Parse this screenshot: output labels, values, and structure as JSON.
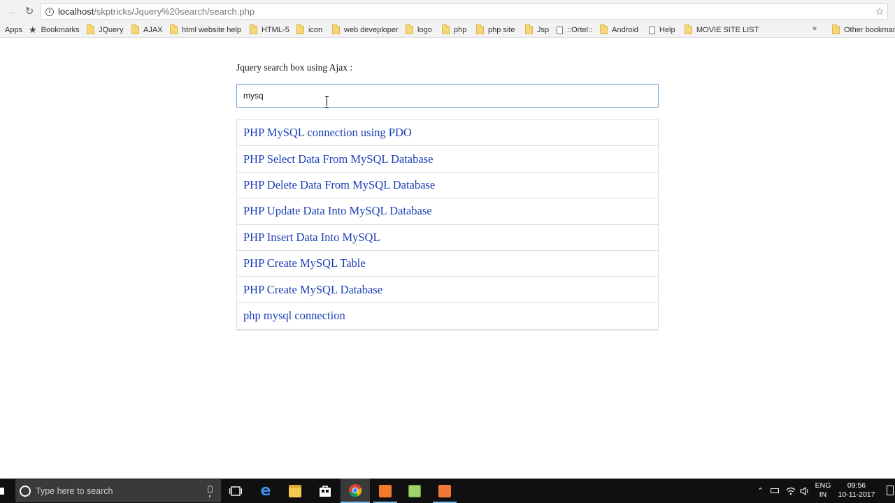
{
  "browser": {
    "url_host": "localhost",
    "url_path": "/skptricks/Jquery%20search/search.php"
  },
  "bookmarks": {
    "apps": "Apps",
    "items": [
      {
        "label": "Bookmarks",
        "icon": "star-icon"
      },
      {
        "label": "JQuery",
        "icon": "folder-icon"
      },
      {
        "label": "AJAX",
        "icon": "folder-icon"
      },
      {
        "label": "html website help",
        "icon": "folder-icon"
      },
      {
        "label": "HTML-5",
        "icon": "folder-icon"
      },
      {
        "label": "icon",
        "icon": "folder-icon"
      },
      {
        "label": "web deveploper",
        "icon": "folder-icon"
      },
      {
        "label": "logo",
        "icon": "folder-icon"
      },
      {
        "label": "php",
        "icon": "folder-icon"
      },
      {
        "label": "php site",
        "icon": "folder-icon"
      },
      {
        "label": "Jsp",
        "icon": "folder-icon"
      },
      {
        "label": "::Ortel::",
        "icon": "page-icon"
      },
      {
        "label": "Android",
        "icon": "folder-icon"
      },
      {
        "label": "Help",
        "icon": "page-icon"
      },
      {
        "label": "MOVIE SITE LIST",
        "icon": "folder-icon"
      }
    ],
    "more": "»",
    "other": "Other bookmarks"
  },
  "page": {
    "heading": "Jquery search box using Ajax :",
    "search_value": "mysq",
    "results": [
      "PHP MySQL connection using PDO",
      "PHP Select Data From MySQL Database",
      "PHP Delete Data From MySQL Database",
      "PHP Update Data Into MySQL Database",
      "PHP Insert Data Into MySQL",
      "PHP Create MySQL Table",
      "PHP Create MySQL Database",
      "php mysql connection"
    ]
  },
  "taskbar": {
    "search_placeholder": "Type here to search",
    "lang_top": "ENG",
    "lang_bottom": "IN",
    "time": "09:56",
    "date": "10-11-2017"
  },
  "colors": {
    "link": "#1a3fb5",
    "input_border": "#7aa7d8"
  }
}
